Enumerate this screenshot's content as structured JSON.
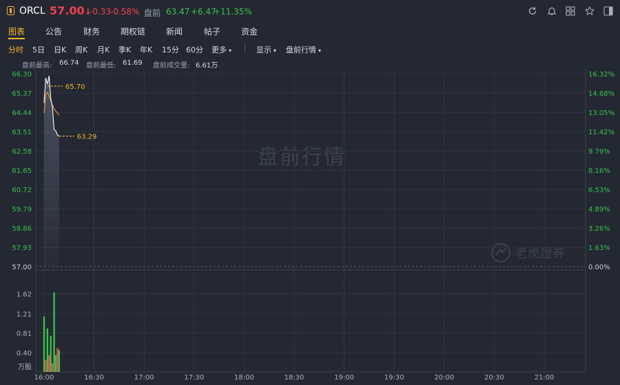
{
  "header": {
    "badge_icon": "stock-badge-icon",
    "ticker": "ORCL",
    "price": "57.00",
    "price_arrow": "↓",
    "change": "-0.33",
    "change_pct": "-0.58%",
    "premarket_label": "盘前",
    "premarket_price": "63.47",
    "premarket_change": "+6.47",
    "premarket_pct": "+11.35%"
  },
  "toolbar_icons": [
    "refresh-icon",
    "bell-icon",
    "grid-icon",
    "star-icon",
    "sidebar-icon"
  ],
  "tabs": [
    {
      "label": "图表",
      "active": true
    },
    {
      "label": "公告",
      "active": false
    },
    {
      "label": "财务",
      "active": false
    },
    {
      "label": "期权链",
      "active": false
    },
    {
      "label": "新闻",
      "active": false
    },
    {
      "label": "帖子",
      "active": false
    },
    {
      "label": "资金",
      "active": false
    }
  ],
  "periods": [
    {
      "label": "分时",
      "active": true
    },
    {
      "label": "5日"
    },
    {
      "label": "日K"
    },
    {
      "label": "周K"
    },
    {
      "label": "月K"
    },
    {
      "label": "季K"
    },
    {
      "label": "年K"
    },
    {
      "label": "15分"
    },
    {
      "label": "60分"
    },
    {
      "label": "更多"
    }
  ],
  "view_menus": [
    {
      "label": "显示"
    },
    {
      "label": "盘前行情"
    }
  ],
  "stats": {
    "high_label": "盘前最高:",
    "high": "66.74",
    "low_label": "盘前最低:",
    "low": "61.69",
    "vol_label": "盘前成交量:",
    "vol": "6.61万"
  },
  "watermark": "盘前行情",
  "brand_watermark": "老虎證券",
  "colors": {
    "up": "#f0434b",
    "down": "#37c24a",
    "accent": "#f5b42c",
    "bg": "#232833"
  },
  "chart_data": {
    "type": "line",
    "title": "",
    "x_ticks": [
      "16:00",
      "16:30",
      "17:00",
      "17:30",
      "18:00",
      "18:30",
      "19:00",
      "19:30",
      "20:00",
      "20:30",
      "21:00"
    ],
    "y_left_ticks": [
      "66.30",
      "65.37",
      "64.44",
      "63.51",
      "62.58",
      "61.65",
      "60.72",
      "59.79",
      "58.86",
      "57.93",
      "57.00"
    ],
    "y_right_ticks": [
      "16.32%",
      "14.68%",
      "13.05%",
      "11.42%",
      "9.79%",
      "8.16%",
      "6.53%",
      "4.89%",
      "3.26%",
      "1.63%",
      "0.00%"
    ],
    "ylim": [
      57.0,
      66.3
    ],
    "reference_price": 57.0,
    "price_series": {
      "x": [
        "16:00",
        "16:01",
        "16:02",
        "16:03",
        "16:04",
        "16:05",
        "16:06",
        "16:07",
        "16:08",
        "16:09"
      ],
      "values": [
        64.9,
        66.1,
        65.8,
        66.2,
        65.1,
        64.7,
        63.6,
        63.55,
        63.35,
        63.29
      ]
    },
    "avg_series": {
      "x": [
        "16:00",
        "16:01",
        "16:02",
        "16:03",
        "16:04",
        "16:05",
        "16:06",
        "16:07",
        "16:08",
        "16:09"
      ],
      "values": [
        64.4,
        65.3,
        65.4,
        65.2,
        65.0,
        64.8,
        64.6,
        64.5,
        64.4,
        64.3
      ]
    },
    "annotations": [
      {
        "label": "65.70",
        "value": 65.7
      },
      {
        "label": "63.29",
        "value": 63.29
      }
    ],
    "volume": {
      "unit_label": "万股",
      "y_ticks": [
        "1.62",
        "1.21",
        "0.81",
        "0.40"
      ],
      "ylim": [
        0,
        2.0
      ],
      "x": [
        "16:00",
        "16:01",
        "16:02",
        "16:03",
        "16:04",
        "16:05",
        "16:06",
        "16:07",
        "16:08",
        "16:09"
      ],
      "values": [
        1.15,
        0.25,
        0.9,
        0.35,
        0.75,
        0.18,
        1.65,
        0.35,
        0.5,
        0.45
      ],
      "up": [
        true,
        false,
        true,
        false,
        true,
        false,
        true,
        true,
        false,
        true
      ]
    }
  }
}
